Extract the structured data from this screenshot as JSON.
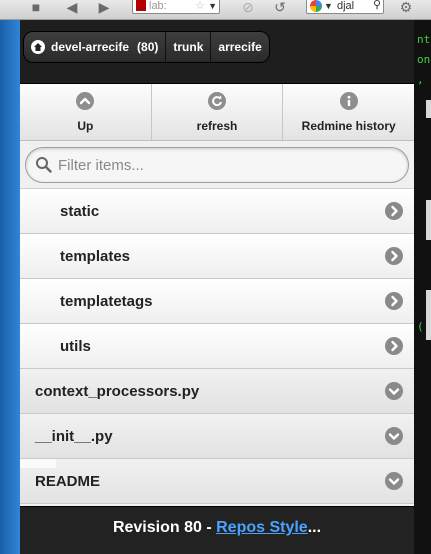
{
  "browser": {
    "url_text": "lab:",
    "search_text": "djal"
  },
  "breadcrumb": {
    "items": [
      {
        "label": "devel-arrecife",
        "count": "(80)"
      },
      {
        "label": "trunk"
      },
      {
        "label": "arrecife"
      }
    ]
  },
  "toolbar": {
    "buttons": [
      {
        "label": "Up",
        "icon": "chevron-up-icon"
      },
      {
        "label": "refresh",
        "icon": "refresh-icon"
      },
      {
        "label": "Redmine history",
        "icon": "info-icon"
      }
    ]
  },
  "filter": {
    "placeholder": "Filter items...",
    "value": ""
  },
  "items": [
    {
      "label": "static",
      "kind": "folder",
      "icon": "chevron-right-icon"
    },
    {
      "label": "templates",
      "kind": "folder",
      "icon": "chevron-right-icon"
    },
    {
      "label": "templatetags",
      "kind": "folder",
      "icon": "chevron-right-icon"
    },
    {
      "label": "utils",
      "kind": "folder",
      "icon": "chevron-right-icon"
    },
    {
      "label": "context_processors.py",
      "kind": "file",
      "icon": "chevron-down-icon"
    },
    {
      "label": "__init__.py",
      "kind": "file",
      "icon": "chevron-down-icon"
    },
    {
      "label": "README",
      "kind": "file",
      "icon": "chevron-down-icon"
    }
  ],
  "footer": {
    "prefix": "Revision 80 - ",
    "link": "Repos Style",
    "suffix": "..."
  },
  "colors": {
    "header_bg": "#1e1e1e",
    "icon_gray": "#8a8a8a",
    "link_blue": "#4aa3ff",
    "desktop_blue": "#2f86d6"
  }
}
